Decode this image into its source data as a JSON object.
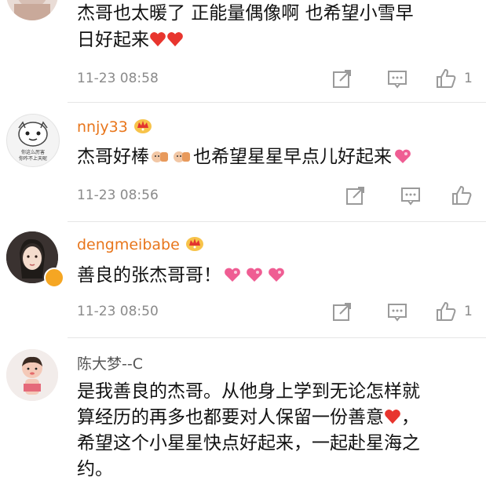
{
  "comments": [
    {
      "name": "",
      "text_line1": "杰哥也太暖了 正能量偶像啊 也希望小雪早",
      "text_line2": "日好起来",
      "time": "11-23 08:58",
      "like_count": "1"
    },
    {
      "name": "nnjy33",
      "text_a": "杰哥好棒",
      "text_b": "也希望星星早点儿好起来",
      "time": "11-23 08:56",
      "like_count": "",
      "avatar_caption_1": "你这么厉害",
      "avatar_caption_2": "你咋不上天呢"
    },
    {
      "name": "dengmeibabe",
      "text": "善良的张杰哥哥！",
      "time": "11-23 08:50",
      "like_count": "1"
    },
    {
      "name": "陈大梦--C",
      "text_line1": "是我善良的杰哥。从他身上学到无论怎样就",
      "text_line2a": "算经历的再多也都要对人保留一份善意",
      "text_line2b": "，",
      "text_line3": "希望这个小星星快点好起来，一起赴星海之",
      "text_line4": "约。"
    }
  ],
  "colors": {
    "vip_name": "#e8761c",
    "plain_name": "#555555",
    "meta": "#8a8a8a",
    "heart": "#e8352e"
  },
  "icons": [
    "share-icon",
    "comment-icon",
    "like-icon",
    "heart-emoji",
    "crown-vip-icon",
    "verified-badge-icon"
  ]
}
